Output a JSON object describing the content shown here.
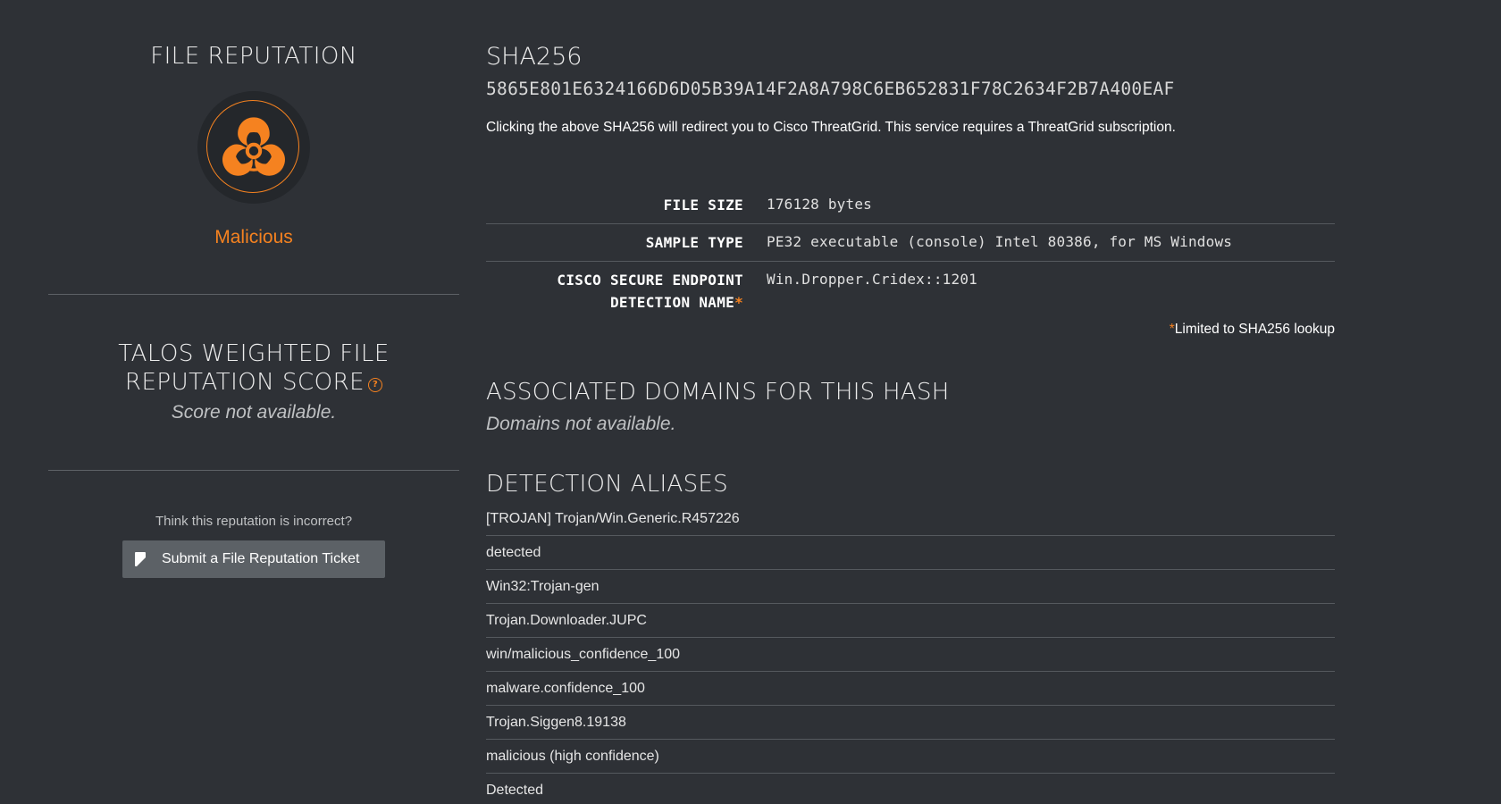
{
  "reputation": {
    "title": "FILE REPUTATION",
    "icon": "biohazard-icon",
    "verdict": "Malicious",
    "verdict_color": "#f58220"
  },
  "score": {
    "title": "TALOS WEIGHTED FILE REPUTATION SCORE",
    "help_icon": "question-circle-icon",
    "help_glyph": "?",
    "value": "Score not available."
  },
  "ticket": {
    "question": "Think this reputation is incorrect?",
    "button_label": "Submit a File Reputation Ticket",
    "button_icon": "document-icon"
  },
  "hash": {
    "label": "SHA256",
    "value": "5865E801E6324166D6D05B39A14F2A8A798C6EB652831F78C2634F2B7A400EAF",
    "note": "Clicking the above SHA256 will redirect you to Cisco ThreatGrid. This service requires a ThreatGrid subscription."
  },
  "details": {
    "file_size_label": "FILE SIZE",
    "file_size_value": "176128 bytes",
    "sample_type_label": "SAMPLE TYPE",
    "sample_type_value": "PE32 executable (console) Intel 80386, for MS Windows",
    "detection_label_line1": "CISCO SECURE ENDPOINT",
    "detection_label_line2": "DETECTION NAME",
    "asterisk": "*",
    "detection_value": "Win.Dropper.Cridex::1201",
    "limited_note": "Limited to SHA256 lookup"
  },
  "domains": {
    "title": "ASSOCIATED DOMAINS FOR THIS HASH",
    "value": "Domains not available."
  },
  "aliases": {
    "title": "DETECTION ALIASES",
    "items": [
      "[TROJAN] Trojan/Win.Generic.R457226",
      "detected",
      "Win32:Trojan-gen",
      "Trojan.Downloader.JUPC",
      "win/malicious_confidence_100",
      "malware.confidence_100",
      "Trojan.Siggen8.19138",
      "malicious (high confidence)",
      "Detected"
    ]
  },
  "colors": {
    "background": "#2e3136",
    "accent": "#f58220",
    "button": "#5c6166"
  }
}
